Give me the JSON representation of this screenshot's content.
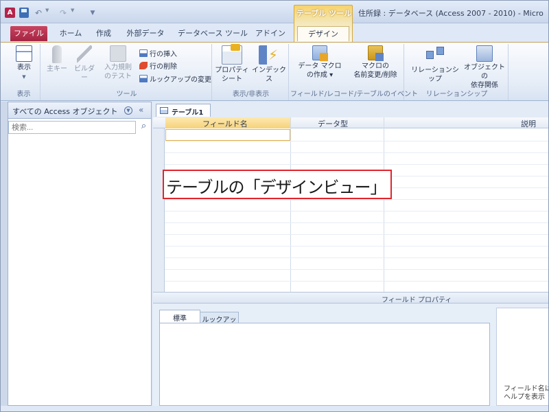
{
  "window": {
    "app_badge": "A",
    "title": "住所録 : データベース (Access 2007 - 2010) - Micro",
    "context_group": "テーブル ツール"
  },
  "tabs": [
    "ファイル",
    "ホーム",
    "作成",
    "外部データ",
    "データベース ツール",
    "アドイン",
    "デザイン"
  ],
  "ribbon": {
    "groups": [
      {
        "label": "表示"
      },
      {
        "label": "ツール"
      },
      {
        "label": "表示/非表示"
      },
      {
        "label": "フィールド/レコード/テーブルのイベント"
      },
      {
        "label": "リレーションシップ"
      }
    ],
    "buttons": {
      "view": "表示",
      "primary_key": "主キー",
      "builder": "ビルダー",
      "test_rules_1": "入力規則",
      "test_rules_2": "のテスト",
      "insert_rows": "行の挿入",
      "delete_rows": "行の削除",
      "modify_lookups": "ルックアップの変更",
      "property_sheet_1": "プロパティ",
      "property_sheet_2": "シート",
      "indexes": "インデックス",
      "data_macro_1": "データ マクロ",
      "data_macro_2": "の作成 ▾",
      "rename_macro_1": "マクロの",
      "rename_macro_2": "名前変更/削除",
      "relationships": "リレーションシップ",
      "dependencies_1": "オブジェクトの",
      "dependencies_2": "依存関係"
    }
  },
  "nav_pane": {
    "header": "すべての Access オブジェクト",
    "search_placeholder": "検索..."
  },
  "document": {
    "tab_name": "テーブル1",
    "columns": [
      "フィールド名",
      "データ型",
      "説明"
    ]
  },
  "annotation": {
    "text": "テーブルの「デザインビュー」"
  },
  "field_properties": {
    "label": "フィールド プロパティ",
    "tabs": [
      "標準",
      "ルックアップ"
    ],
    "help_text_1": "フィールド名は",
    "help_text_2": "ヘルプを表示"
  }
}
